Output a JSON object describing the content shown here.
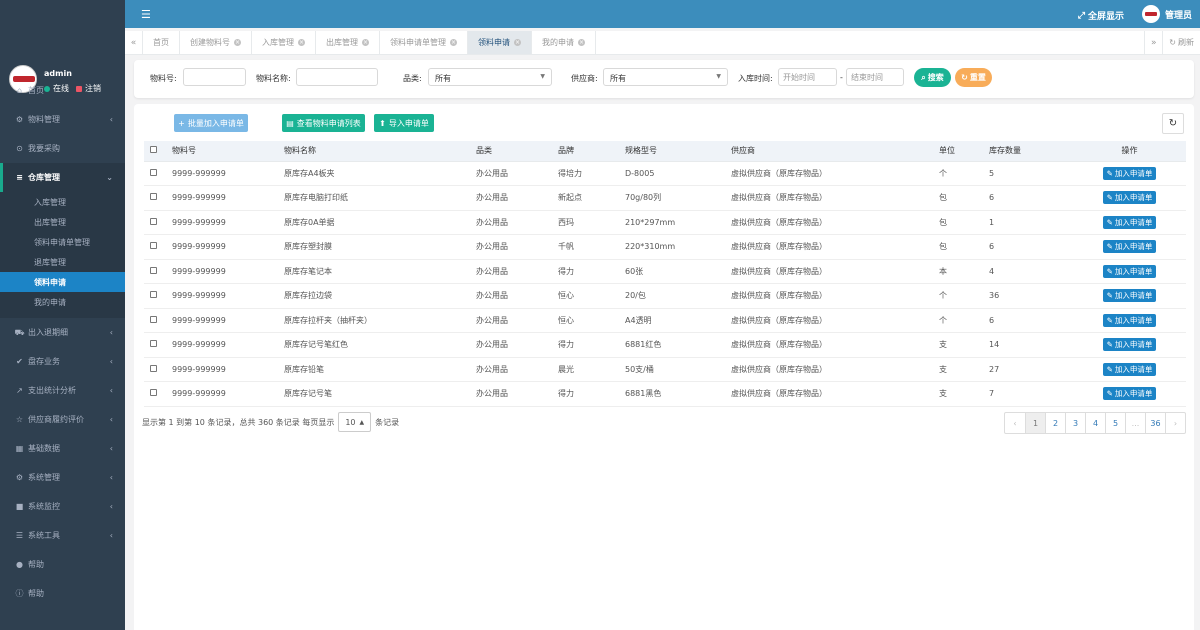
{
  "sidebar": {
    "user": {
      "name": "admin",
      "online": "在线",
      "logout": "注销"
    },
    "menu": [
      {
        "icon": "home-icon",
        "glyph": "⌂",
        "label": "首页",
        "caret": false
      },
      {
        "icon": "cubes-icon",
        "glyph": "⚙",
        "label": "物料管理",
        "caret": true
      },
      {
        "icon": "cart-circle-icon",
        "glyph": "⊙",
        "label": "我要采购",
        "caret": false
      },
      {
        "icon": "database-icon",
        "glyph": "≡",
        "label": "仓库管理",
        "caret": true,
        "open": true
      }
    ],
    "submenu": [
      {
        "label": "入库管理",
        "active": false
      },
      {
        "label": "出库管理",
        "active": false
      },
      {
        "label": "领料申请单管理",
        "active": false
      },
      {
        "label": "退库管理",
        "active": false
      },
      {
        "label": "领料申请",
        "active": true
      },
      {
        "label": "我的申请",
        "active": false
      }
    ],
    "menu2": [
      {
        "icon": "cart-icon",
        "glyph": "⛟",
        "label": "出入退期细",
        "caret": true
      },
      {
        "icon": "check-icon",
        "glyph": "✔",
        "label": "盘存业务",
        "caret": true
      },
      {
        "icon": "chart-icon",
        "glyph": "↗",
        "label": "支出统计分析",
        "caret": true
      },
      {
        "icon": "star-icon",
        "glyph": "☆",
        "label": "供应商履约评价",
        "caret": true
      },
      {
        "icon": "table-icon",
        "glyph": "▦",
        "label": "基础数据",
        "caret": true
      },
      {
        "icon": "gear-icon",
        "glyph": "⚙",
        "label": "系统管理",
        "caret": true
      },
      {
        "icon": "video-icon",
        "glyph": "■",
        "label": "系统监控",
        "caret": true
      },
      {
        "icon": "list-icon",
        "glyph": "☰",
        "label": "系统工具",
        "caret": true
      },
      {
        "icon": "chat-icon",
        "glyph": "●",
        "label": "帮助",
        "caret": false
      },
      {
        "icon": "info-icon",
        "glyph": "ⓘ",
        "label": "帮助",
        "caret": false
      }
    ]
  },
  "topbar": {
    "fullscreen": "全屏显示",
    "admin_label": "管理员"
  },
  "tabs": [
    {
      "label": "首页",
      "closable": false,
      "active": false
    },
    {
      "label": "创建物料号",
      "closable": true,
      "active": false
    },
    {
      "label": "入库管理",
      "closable": true,
      "active": false
    },
    {
      "label": "出库管理",
      "closable": true,
      "active": false
    },
    {
      "label": "领料申请单管理",
      "closable": true,
      "active": false
    },
    {
      "label": "领料申请",
      "closable": true,
      "active": true
    },
    {
      "label": "我的申请",
      "closable": true,
      "active": false
    }
  ],
  "tabbar_refresh": "刷新",
  "search": {
    "material_no_label": "物料号:",
    "material_name_label": "物料名称:",
    "category_label": "品类:",
    "category_value": "所有",
    "supplier_label": "供应商:",
    "supplier_value": "所有",
    "date_label": "入库时间:",
    "start_placeholder": "开始时间",
    "end_placeholder": "结束时间",
    "date_sep": "-",
    "search_btn": "搜索",
    "reset_btn": "重置"
  },
  "toolbar": {
    "batch_add": "批量加入申请单",
    "view_list": "查看物料申请列表",
    "import": "导入申请单"
  },
  "table": {
    "headers": [
      "物料号",
      "物料名称",
      "品类",
      "品牌",
      "规格型号",
      "供应商",
      "单位",
      "库存数量",
      "操作"
    ],
    "action_label": "加入申请单",
    "rows": [
      {
        "no": "9999-999999",
        "name": "原库存A4板夹",
        "cat": "办公用品",
        "brand": "得培力",
        "spec": "D-8005",
        "supplier": "虚拟供应商（原库存物品）",
        "unit": "个",
        "qty": "5"
      },
      {
        "no": "9999-999999",
        "name": "原库存电脑打印纸",
        "cat": "办公用品",
        "brand": "新起点",
        "spec": "70g/80列",
        "supplier": "虚拟供应商（原库存物品）",
        "unit": "包",
        "qty": "6"
      },
      {
        "no": "9999-999999",
        "name": "原库存0A单据",
        "cat": "办公用品",
        "brand": "西玛",
        "spec": "210*297mm",
        "supplier": "虚拟供应商（原库存物品）",
        "unit": "包",
        "qty": "1"
      },
      {
        "no": "9999-999999",
        "name": "原库存塑封膜",
        "cat": "办公用品",
        "brand": "千帆",
        "spec": "220*310mm",
        "supplier": "虚拟供应商（原库存物品）",
        "unit": "包",
        "qty": "6"
      },
      {
        "no": "9999-999999",
        "name": "原库存笔记本",
        "cat": "办公用品",
        "brand": "得力",
        "spec": "60张",
        "supplier": "虚拟供应商（原库存物品）",
        "unit": "本",
        "qty": "4"
      },
      {
        "no": "9999-999999",
        "name": "原库存拉边袋",
        "cat": "办公用品",
        "brand": "恒心",
        "spec": "20/包",
        "supplier": "虚拟供应商（原库存物品）",
        "unit": "个",
        "qty": "36"
      },
      {
        "no": "9999-999999",
        "name": "原库存拉杆夹（抽杆夹）",
        "cat": "办公用品",
        "brand": "恒心",
        "spec": "A4透明",
        "supplier": "虚拟供应商（原库存物品）",
        "unit": "个",
        "qty": "6"
      },
      {
        "no": "9999-999999",
        "name": "原库存记号笔红色",
        "cat": "办公用品",
        "brand": "得力",
        "spec": "6881红色",
        "supplier": "虚拟供应商（原库存物品）",
        "unit": "支",
        "qty": "14"
      },
      {
        "no": "9999-999999",
        "name": "原库存铅笔",
        "cat": "办公用品",
        "brand": "晨光",
        "spec": "50支/桶",
        "supplier": "虚拟供应商（原库存物品）",
        "unit": "支",
        "qty": "27"
      },
      {
        "no": "9999-999999",
        "name": "原库存记号笔",
        "cat": "办公用品",
        "brand": "得力",
        "spec": "6881黑色",
        "supplier": "虚拟供应商（原库存物品）",
        "unit": "支",
        "qty": "7"
      }
    ]
  },
  "pager": {
    "info_prefix": "显示第 1 到第 10 条记录，总共 360 条记录  每页显示",
    "page_size": "10",
    "info_suffix": "条记录",
    "pages": [
      "‹",
      "1",
      "2",
      "3",
      "4",
      "5",
      "...",
      "36",
      "›"
    ],
    "active_page": "1"
  },
  "colors": {
    "sidebar_bg": "#2f4050",
    "topbar_bg": "#3c8dbc",
    "primary": "#1c84c6",
    "success": "#1ab394",
    "warning": "#f8ac59",
    "info_light": "#7ab8e6"
  }
}
